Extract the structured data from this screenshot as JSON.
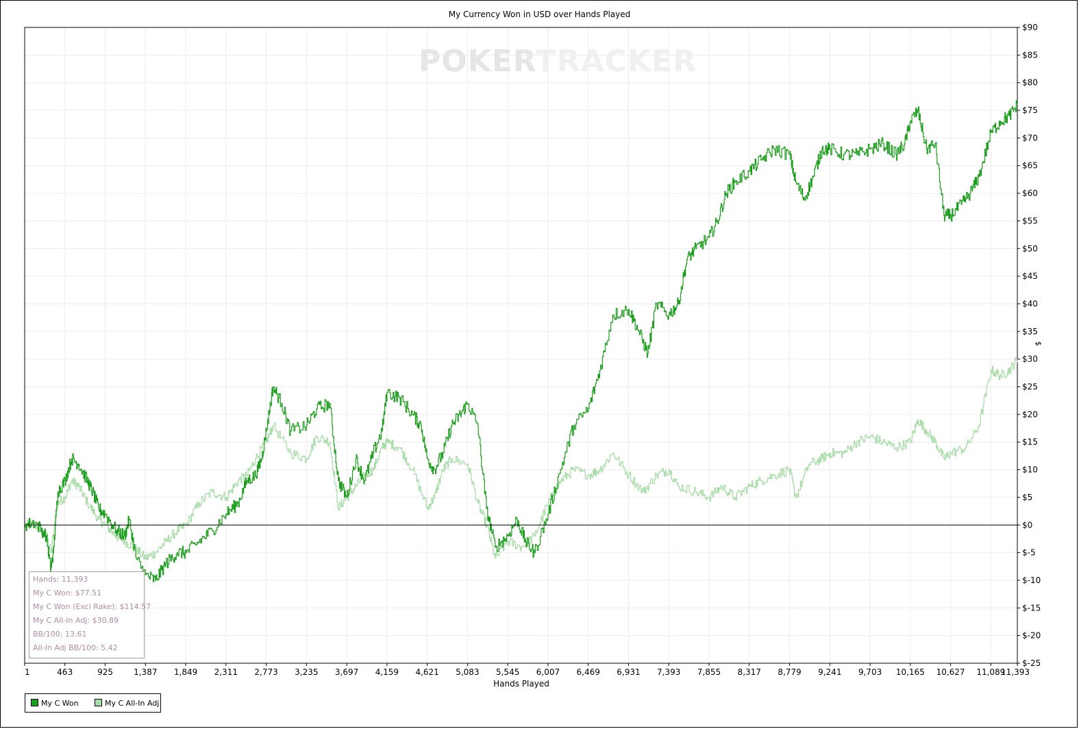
{
  "chart_data": {
    "type": "line",
    "title": "My Currency Won in USD over Hands Played",
    "xlabel": "Hands Played",
    "ylabel": "$",
    "xlim": [
      1,
      11393
    ],
    "ylim": [
      -25,
      90
    ],
    "x_ticks": [
      "1",
      "463",
      "925",
      "1,387",
      "1,849",
      "2,311",
      "2,773",
      "3,235",
      "3,697",
      "4,159",
      "4,621",
      "5,083",
      "5,545",
      "6,007",
      "6,469",
      "6,931",
      "7,393",
      "7,855",
      "8,317",
      "8,779",
      "9,241",
      "9,703",
      "10,165",
      "10,627",
      "11,089",
      "11,393"
    ],
    "y_ticks": [
      "$90",
      "$85",
      "$80",
      "$75",
      "$70",
      "$65",
      "$60",
      "$55",
      "$50",
      "$45",
      "$40",
      "$35",
      "$30",
      "$25",
      "$20",
      "$15",
      "$10",
      "$5",
      "$0",
      "$-5",
      "$-10",
      "$-15",
      "$-20",
      "$-25"
    ],
    "y_tick_values": [
      90,
      85,
      80,
      75,
      70,
      65,
      60,
      55,
      50,
      45,
      40,
      35,
      30,
      25,
      20,
      15,
      10,
      5,
      0,
      -5,
      -10,
      -15,
      -20,
      -25
    ],
    "grid": true,
    "legend_position": "bottom-left",
    "series": [
      {
        "name": "My C Won",
        "color": "#1e9e1e",
        "points": [
          [
            1,
            0
          ],
          [
            120,
            0.5
          ],
          [
            250,
            -2
          ],
          [
            300,
            -8
          ],
          [
            330,
            -5
          ],
          [
            380,
            6
          ],
          [
            463,
            8
          ],
          [
            540,
            12
          ],
          [
            620,
            11
          ],
          [
            720,
            8
          ],
          [
            780,
            6
          ],
          [
            850,
            3
          ],
          [
            925,
            2
          ],
          [
            1050,
            -1
          ],
          [
            1150,
            -2
          ],
          [
            1200,
            1
          ],
          [
            1280,
            -6
          ],
          [
            1387,
            -9
          ],
          [
            1500,
            -10
          ],
          [
            1620,
            -7
          ],
          [
            1750,
            -5
          ],
          [
            1849,
            -5
          ],
          [
            2000,
            -3
          ],
          [
            2150,
            -1
          ],
          [
            2311,
            2
          ],
          [
            2450,
            4
          ],
          [
            2550,
            8
          ],
          [
            2650,
            9
          ],
          [
            2720,
            12
          ],
          [
            2773,
            17
          ],
          [
            2850,
            25
          ],
          [
            2950,
            22
          ],
          [
            3050,
            17
          ],
          [
            3235,
            18
          ],
          [
            3350,
            21
          ],
          [
            3500,
            22
          ],
          [
            3600,
            8
          ],
          [
            3697,
            5
          ],
          [
            3800,
            12
          ],
          [
            3900,
            8
          ],
          [
            4000,
            13
          ],
          [
            4100,
            17
          ],
          [
            4159,
            24
          ],
          [
            4300,
            23
          ],
          [
            4450,
            20
          ],
          [
            4550,
            18
          ],
          [
            4621,
            12
          ],
          [
            4700,
            10
          ],
          [
            4800,
            13
          ],
          [
            4900,
            18
          ],
          [
            5000,
            20
          ],
          [
            5083,
            22
          ],
          [
            5200,
            18
          ],
          [
            5300,
            3
          ],
          [
            5400,
            -4
          ],
          [
            5545,
            -2
          ],
          [
            5650,
            1
          ],
          [
            5750,
            -3
          ],
          [
            5850,
            -5
          ],
          [
            6007,
            2
          ],
          [
            6150,
            10
          ],
          [
            6300,
            18
          ],
          [
            6469,
            21
          ],
          [
            6600,
            28
          ],
          [
            6750,
            38
          ],
          [
            6931,
            39
          ],
          [
            7050,
            35
          ],
          [
            7150,
            31
          ],
          [
            7250,
            40
          ],
          [
            7393,
            38
          ],
          [
            7500,
            40
          ],
          [
            7600,
            48
          ],
          [
            7700,
            50
          ],
          [
            7855,
            52
          ],
          [
            7950,
            55
          ],
          [
            8050,
            60
          ],
          [
            8150,
            62
          ],
          [
            8317,
            64
          ],
          [
            8450,
            66
          ],
          [
            8600,
            68
          ],
          [
            8779,
            67
          ],
          [
            8850,
            62
          ],
          [
            8950,
            59
          ],
          [
            9050,
            63
          ],
          [
            9150,
            68
          ],
          [
            9241,
            68
          ],
          [
            9400,
            67
          ],
          [
            9550,
            67
          ],
          [
            9703,
            68
          ],
          [
            9850,
            69
          ],
          [
            10000,
            67
          ],
          [
            10100,
            69
          ],
          [
            10165,
            73
          ],
          [
            10250,
            75
          ],
          [
            10350,
            68
          ],
          [
            10450,
            69
          ],
          [
            10550,
            56
          ],
          [
            10627,
            56
          ],
          [
            10750,
            58
          ],
          [
            10850,
            60
          ],
          [
            10950,
            63
          ],
          [
            11089,
            71
          ],
          [
            11200,
            73
          ],
          [
            11300,
            74
          ],
          [
            11393,
            76
          ]
        ]
      },
      {
        "name": "My C All-In Adj",
        "color": "#a8dca8",
        "points": [
          [
            1,
            0
          ],
          [
            120,
            0
          ],
          [
            250,
            -2
          ],
          [
            300,
            -5
          ],
          [
            380,
            4
          ],
          [
            463,
            5
          ],
          [
            540,
            8
          ],
          [
            620,
            7
          ],
          [
            720,
            4
          ],
          [
            850,
            1
          ],
          [
            925,
            0
          ],
          [
            1050,
            -2
          ],
          [
            1150,
            -3
          ],
          [
            1250,
            -4
          ],
          [
            1387,
            -6
          ],
          [
            1500,
            -5
          ],
          [
            1620,
            -3
          ],
          [
            1750,
            -1
          ],
          [
            1849,
            0
          ],
          [
            2000,
            4
          ],
          [
            2150,
            6
          ],
          [
            2311,
            5
          ],
          [
            2450,
            8
          ],
          [
            2550,
            9
          ],
          [
            2650,
            12
          ],
          [
            2773,
            15
          ],
          [
            2850,
            18
          ],
          [
            3050,
            13
          ],
          [
            3235,
            12
          ],
          [
            3350,
            16
          ],
          [
            3500,
            15
          ],
          [
            3600,
            3
          ],
          [
            3697,
            5
          ],
          [
            3800,
            7
          ],
          [
            3900,
            9
          ],
          [
            4000,
            10
          ],
          [
            4100,
            14
          ],
          [
            4159,
            15
          ],
          [
            4300,
            14
          ],
          [
            4450,
            10
          ],
          [
            4621,
            3
          ],
          [
            4700,
            5
          ],
          [
            4800,
            10
          ],
          [
            4900,
            12
          ],
          [
            5083,
            11
          ],
          [
            5200,
            4
          ],
          [
            5300,
            0
          ],
          [
            5400,
            -6
          ],
          [
            5545,
            -3
          ],
          [
            5700,
            -4
          ],
          [
            5850,
            -2
          ],
          [
            6007,
            4
          ],
          [
            6150,
            8
          ],
          [
            6300,
            10
          ],
          [
            6469,
            9
          ],
          [
            6600,
            10
          ],
          [
            6750,
            13
          ],
          [
            6931,
            9
          ],
          [
            7100,
            6
          ],
          [
            7250,
            9
          ],
          [
            7393,
            10
          ],
          [
            7500,
            7
          ],
          [
            7700,
            6
          ],
          [
            7855,
            5
          ],
          [
            8000,
            7
          ],
          [
            8150,
            5
          ],
          [
            8317,
            7
          ],
          [
            8450,
            8
          ],
          [
            8600,
            9
          ],
          [
            8779,
            10
          ],
          [
            8850,
            5
          ],
          [
            9000,
            11
          ],
          [
            9150,
            12
          ],
          [
            9241,
            13
          ],
          [
            9400,
            13
          ],
          [
            9550,
            15
          ],
          [
            9703,
            16
          ],
          [
            9850,
            15
          ],
          [
            10000,
            14
          ],
          [
            10165,
            15
          ],
          [
            10250,
            19
          ],
          [
            10350,
            17
          ],
          [
            10450,
            15
          ],
          [
            10550,
            12
          ],
          [
            10627,
            13
          ],
          [
            10800,
            14
          ],
          [
            10950,
            18
          ],
          [
            11089,
            28
          ],
          [
            11200,
            27
          ],
          [
            11300,
            28
          ],
          [
            11393,
            30
          ]
        ]
      }
    ],
    "zero_line": 0
  },
  "stats": {
    "hands": "Hands: 11,393",
    "won": "My C Won: $77.51",
    "won_excl_rake": "My C Won (Excl Rake): $114.57",
    "allin_adj": "My C All-In Adj: $30.89",
    "bb100": "BB/100: 13.61",
    "allin_bb100": "All-In Adj BB/100: 5.42"
  },
  "watermark": {
    "part1": "POKER",
    "part2": "TRACKER"
  },
  "legend": {
    "items": [
      {
        "label": "My C Won",
        "color": "#1e9e1e"
      },
      {
        "label": "My C All-In Adj",
        "color": "#a8dca8"
      }
    ]
  }
}
